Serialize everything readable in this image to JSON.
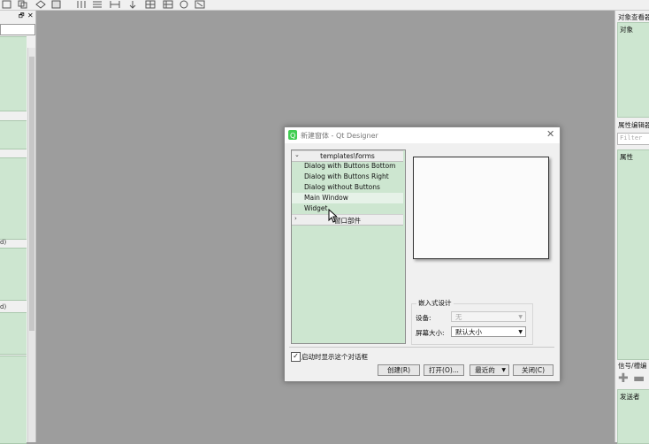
{
  "dialog": {
    "title": "新建窗体 - Qt Designer",
    "close_glyph": "✕",
    "templates": {
      "group1_header": "templates\\forms",
      "items": [
        "Dialog with Buttons Bottom",
        "Dialog with Buttons Right",
        "Dialog without Buttons",
        "Main Window",
        "Widget"
      ],
      "group2_header": "窗口部件"
    },
    "embedded": {
      "title": "嵌入式设计",
      "device_label": "设备:",
      "device_value": "无",
      "screen_label": "屏幕大小:",
      "screen_value": "默认大小"
    },
    "show_on_startup": {
      "label": "启动时显示这个对话框",
      "checked": true
    },
    "buttons": {
      "create": "创建(R)",
      "open": "打开(O)...",
      "recent": "最近的",
      "close": "关闭(C)"
    }
  },
  "right_dock": {
    "object_inspector_title": "对象查看器",
    "object_col": "对象",
    "property_editor_title": "属性编辑器",
    "filter_placeholder": "Filter",
    "property_col": "属性",
    "signal_slot_title": "信号/槽编",
    "sender_col": "发送者"
  },
  "left_dock": {
    "label1": "d)",
    "label2": "d)"
  },
  "colors": {
    "workspace": "#9d9d9d",
    "list_green": "#cde6d0",
    "panel": "#f0f0f0"
  }
}
